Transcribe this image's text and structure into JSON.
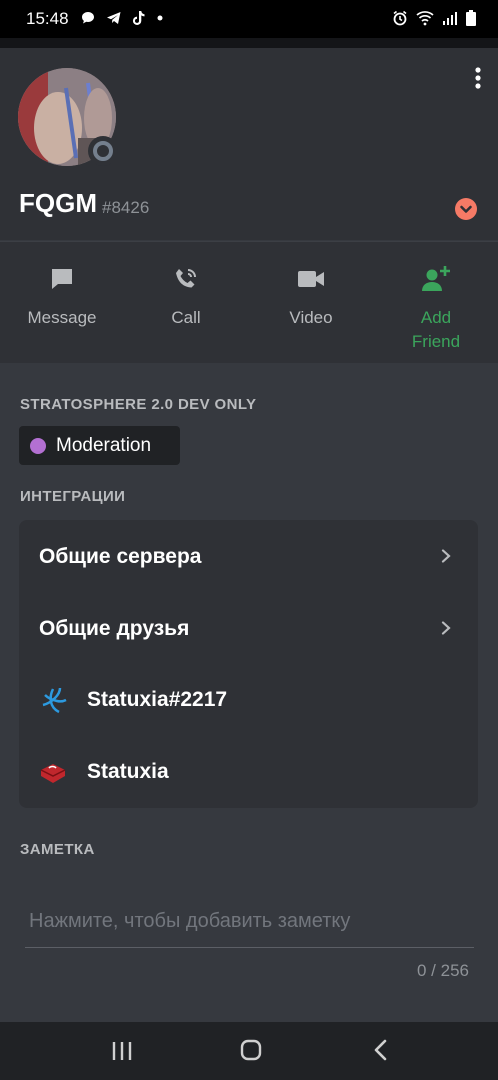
{
  "status_bar": {
    "time": "15:48"
  },
  "profile": {
    "username": "FQGM",
    "discriminator": "#8426"
  },
  "actions": [
    {
      "label": "Message",
      "icon": "message-icon"
    },
    {
      "label": "Call",
      "icon": "phone-icon"
    },
    {
      "label": "Video",
      "icon": "video-camera-icon"
    },
    {
      "label": "Add Friend",
      "icon": "add-friend-icon",
      "color": "#3ba55c"
    }
  ],
  "roles_section": {
    "heading": "STRATOSPHERE 2.0 DEV ONLY",
    "role": {
      "name": "Moderation",
      "color": "#b370d2"
    }
  },
  "integrations": {
    "heading": "ИНТЕГРАЦИИ",
    "rows": [
      {
        "label": "Общие сервера",
        "icon": "chevron-right-icon"
      },
      {
        "label": "Общие друзья",
        "icon": "chevron-right-icon"
      },
      {
        "label": "Statuxia#2217",
        "icon": "battlenet-icon"
      },
      {
        "label": "Statuxia",
        "icon": "heart-icon"
      }
    ]
  },
  "note": {
    "heading": "ЗАМЕТКА",
    "placeholder": "Нажмите, чтобы добавить заметку",
    "counter": "0 / 256"
  },
  "colors": {
    "background": "#36393f",
    "header": "#2f3136",
    "accent_green": "#3ba55c",
    "badge_salmon": "#f57a66"
  }
}
